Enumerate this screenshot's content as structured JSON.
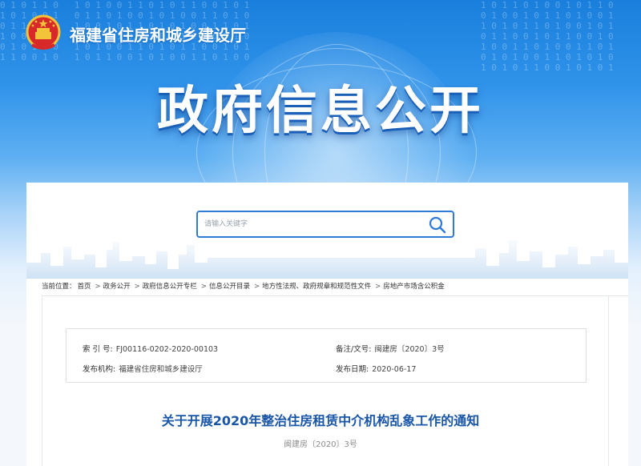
{
  "header": {
    "org_name": "福建省住房和城乡建设厅",
    "page_title": "政府信息公开",
    "emblem_icon": "national-emblem-icon"
  },
  "search": {
    "placeholder": "请输入关键字",
    "button_icon": "search-icon"
  },
  "breadcrumb": {
    "prefix": "当前位置：",
    "items": [
      "首页",
      "政务公开",
      "政府信息公开专栏",
      "信息公开目录",
      "地方性法规、政府规章和规范性文件",
      "房地产市场含公积金"
    ],
    "separator": ">"
  },
  "meta": {
    "index_label": "索 引 号:",
    "index_value": "FJ00116-0202-2020-00103",
    "doc_no_label": "备注/文号:",
    "doc_no_value": "闽建房〔2020〕3号",
    "publisher_label": "发布机构:",
    "publisher_value": "福建省住房和城乡建设厅",
    "date_label": "发布日期:",
    "date_value": "2020-06-17"
  },
  "document": {
    "title": "关于开展2020年整治住房租赁中介机构乱象工作的通知",
    "number": "闽建房〔2020〕3号"
  },
  "colors": {
    "banner_top": "#1a7fdc",
    "accent": "#2f7ad8",
    "title_blue": "#1a56a8"
  }
}
